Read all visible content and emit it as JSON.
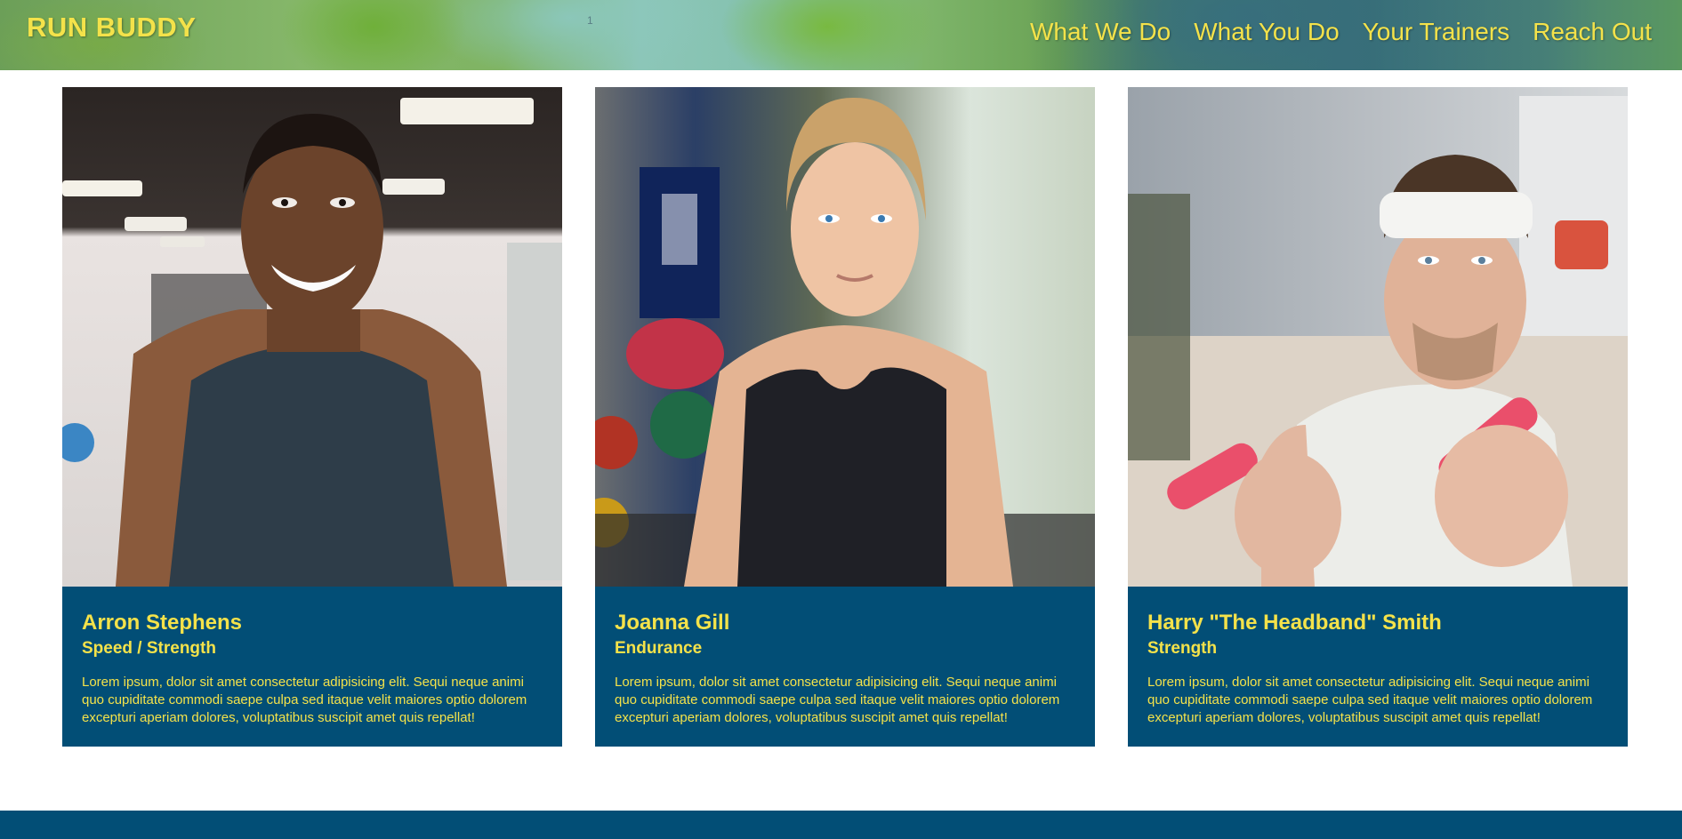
{
  "header": {
    "brand": "RUN BUDDY",
    "marker": "1",
    "nav": [
      {
        "label": "What We Do"
      },
      {
        "label": "What You Do"
      },
      {
        "label": "Your Trainers"
      },
      {
        "label": "Reach Out"
      }
    ]
  },
  "trainers": [
    {
      "name": "Arron Stephens",
      "specialty": "Speed / Strength",
      "bio": "Lorem ipsum, dolor sit amet consectetur adipisicing elit. Sequi neque animi quo cupiditate commodi saepe culpa sed itaque velit maiores optio dolorem excepturi aperiam dolores, voluptatibus suscipit amet quis repellat!"
    },
    {
      "name": "Joanna Gill",
      "specialty": "Endurance",
      "bio": "Lorem ipsum, dolor sit amet consectetur adipisicing elit. Sequi neque animi quo cupiditate commodi saepe culpa sed itaque velit maiores optio dolorem excepturi aperiam dolores, voluptatibus suscipit amet quis repellat!"
    },
    {
      "name": "Harry \"The Headband\" Smith",
      "specialty": "Strength",
      "bio": "Lorem ipsum, dolor sit amet consectetur adipisicing elit. Sequi neque animi quo cupiditate commodi saepe culpa sed itaque velit maiores optio dolorem excepturi aperiam dolores, voluptatibus suscipit amet quis repellat!"
    }
  ],
  "colors": {
    "accent": "#f4e24a",
    "card_bg": "#024e76"
  }
}
